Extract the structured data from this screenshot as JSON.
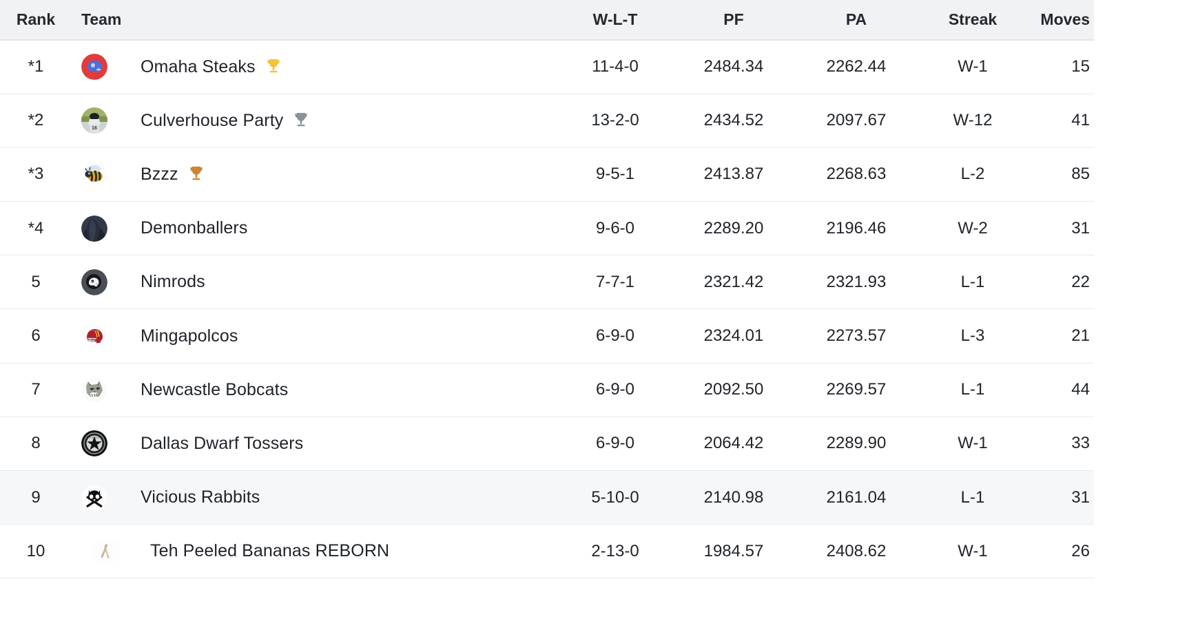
{
  "table": {
    "columns": [
      {
        "key": "rank",
        "label": "Rank"
      },
      {
        "key": "team",
        "label": "Team"
      },
      {
        "key": "wlt",
        "label": "W-L-T"
      },
      {
        "key": "pf",
        "label": "PF"
      },
      {
        "key": "pa",
        "label": "PA"
      },
      {
        "key": "streak",
        "label": "Streak"
      },
      {
        "key": "moves",
        "label": "Moves"
      }
    ],
    "rows": [
      {
        "rank": "*1",
        "team": "Omaha Steaks",
        "logo": "football-helmet-red-blue-icon",
        "trophy": "gold-trophy-icon",
        "trophy_color": "#f5c33b",
        "wlt": "11-4-0",
        "pf": "2484.34",
        "pa": "2262.44",
        "streak": "W-1",
        "moves": "15",
        "highlighted": false,
        "indented": false
      },
      {
        "rank": "*2",
        "team": "Culverhouse Party",
        "logo": "baseball-player-photo-icon",
        "trophy": "silver-trophy-icon",
        "trophy_color": "#8b9199",
        "wlt": "13-2-0",
        "pf": "2434.52",
        "pa": "2097.67",
        "streak": "W-12",
        "moves": "41",
        "highlighted": false,
        "indented": false
      },
      {
        "rank": "*3",
        "team": "Bzzz",
        "logo": "bee-icon",
        "trophy": "bronze-trophy-icon",
        "trophy_color": "#cd8435",
        "wlt": "9-5-1",
        "pf": "2413.87",
        "pa": "2268.63",
        "streak": "L-2",
        "moves": "85",
        "highlighted": false,
        "indented": false
      },
      {
        "rank": "*4",
        "team": "Demonballers",
        "logo": "dark-hooded-figure-icon",
        "trophy": null,
        "trophy_color": null,
        "wlt": "9-6-0",
        "pf": "2289.20",
        "pa": "2196.46",
        "streak": "W-2",
        "moves": "31",
        "highlighted": false,
        "indented": false
      },
      {
        "rank": "5",
        "team": "Nimrods",
        "logo": "dark-helmet-badge-icon",
        "trophy": null,
        "trophy_color": null,
        "wlt": "7-7-1",
        "pf": "2321.42",
        "pa": "2321.93",
        "streak": "L-1",
        "moves": "22",
        "highlighted": false,
        "indented": false
      },
      {
        "rank": "6",
        "team": "Mingapolcos",
        "logo": "red-football-helmet-icon",
        "trophy": null,
        "trophy_color": null,
        "wlt": "6-9-0",
        "pf": "2324.01",
        "pa": "2273.57",
        "streak": "L-3",
        "moves": "21",
        "highlighted": false,
        "indented": false
      },
      {
        "rank": "7",
        "team": "Newcastle Bobcats",
        "logo": "bobcat-head-icon",
        "trophy": null,
        "trophy_color": null,
        "wlt": "6-9-0",
        "pf": "2092.50",
        "pa": "2269.57",
        "streak": "L-1",
        "moves": "44",
        "highlighted": false,
        "indented": false
      },
      {
        "rank": "8",
        "team": "Dallas Dwarf Tossers",
        "logo": "star-badge-icon",
        "trophy": null,
        "trophy_color": null,
        "wlt": "6-9-0",
        "pf": "2064.42",
        "pa": "2289.90",
        "streak": "W-1",
        "moves": "33",
        "highlighted": false,
        "indented": false
      },
      {
        "rank": "9",
        "team": "Vicious Rabbits",
        "logo": "rabbit-skull-crossbones-icon",
        "trophy": null,
        "trophy_color": null,
        "wlt": "5-10-0",
        "pf": "2140.98",
        "pa": "2161.04",
        "streak": "L-1",
        "moves": "31",
        "highlighted": true,
        "indented": false
      },
      {
        "rank": "10",
        "team": "Teh Peeled Bananas REBORN",
        "logo": "banana-peel-icon",
        "trophy": null,
        "trophy_color": null,
        "wlt": "2-13-0",
        "pf": "1984.57",
        "pa": "2408.62",
        "streak": "W-1",
        "moves": "26",
        "highlighted": false,
        "indented": true
      }
    ]
  },
  "colors": {
    "header_background": "#f1f2f4",
    "row_background": "#ffffff",
    "row_highlight_background": "#f6f7f8",
    "row_divider": "#e9eaec",
    "text": "#1f2328"
  }
}
